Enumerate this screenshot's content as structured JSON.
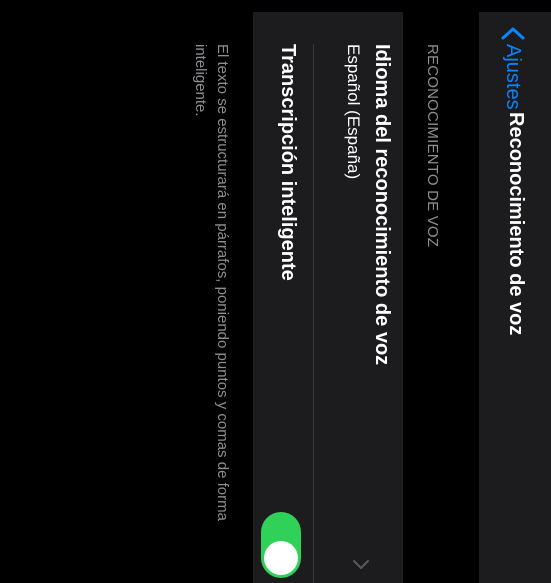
{
  "nav": {
    "back_label": "Ajustes",
    "title": "Reconocimiento de voz"
  },
  "section": {
    "header": "RECONOCIMIENTO DE VOZ"
  },
  "language_row": {
    "title": "Idioma del reconocimiento de voz",
    "value": "Español (España)"
  },
  "smart_transcription": {
    "title": "Transcripción inteligente",
    "enabled": true
  },
  "footer_text": "El texto se estructurará en párrafos, poniendo puntos y comas de forma inteligente.",
  "colors": {
    "accent": "#0a84ff",
    "toggle_on": "#30d158"
  }
}
